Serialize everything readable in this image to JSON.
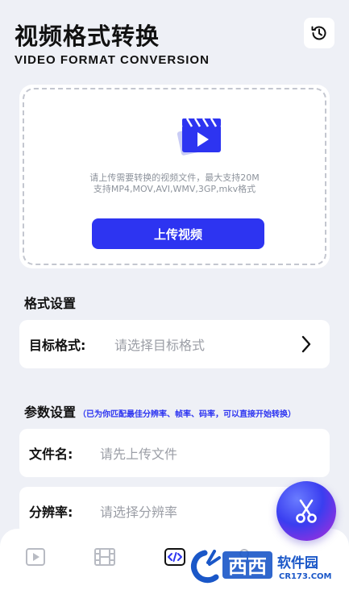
{
  "header": {
    "title": "视频格式转换",
    "subtitle": "VIDEO FORMAT CONVERSION",
    "history_icon": "clock-history-icon"
  },
  "upload": {
    "tip_line1": "请上传需要转换的视频文件，最大支持20M",
    "tip_line2": "支持MP4,MOV,AVI,WMV,3GP,mkv格式",
    "button_label": "上传视频",
    "icon": "video-clapperboard-icon"
  },
  "format_section": {
    "heading": "格式设置",
    "target_label": "目标格式:",
    "target_placeholder": "请选择目标格式"
  },
  "param_section": {
    "heading": "参数设置",
    "note": "（已为你匹配最佳分辨率、帧率、码率，可以直接开始转换）",
    "filename_label": "文件名:",
    "filename_placeholder": "请先上传文件",
    "resolution_label": "分辨率:",
    "resolution_placeholder": "请选择分辨率"
  },
  "tabbar": {
    "tabs": [
      "video-play-icon",
      "film-strip-icon",
      "code-convert-icon",
      "profile-icon"
    ]
  },
  "watermark": {
    "text": "西西",
    "sub": "软件园",
    "url": "CR173.COM"
  },
  "colors": {
    "accent": "#2d34f1",
    "background": "#eef0f6"
  }
}
